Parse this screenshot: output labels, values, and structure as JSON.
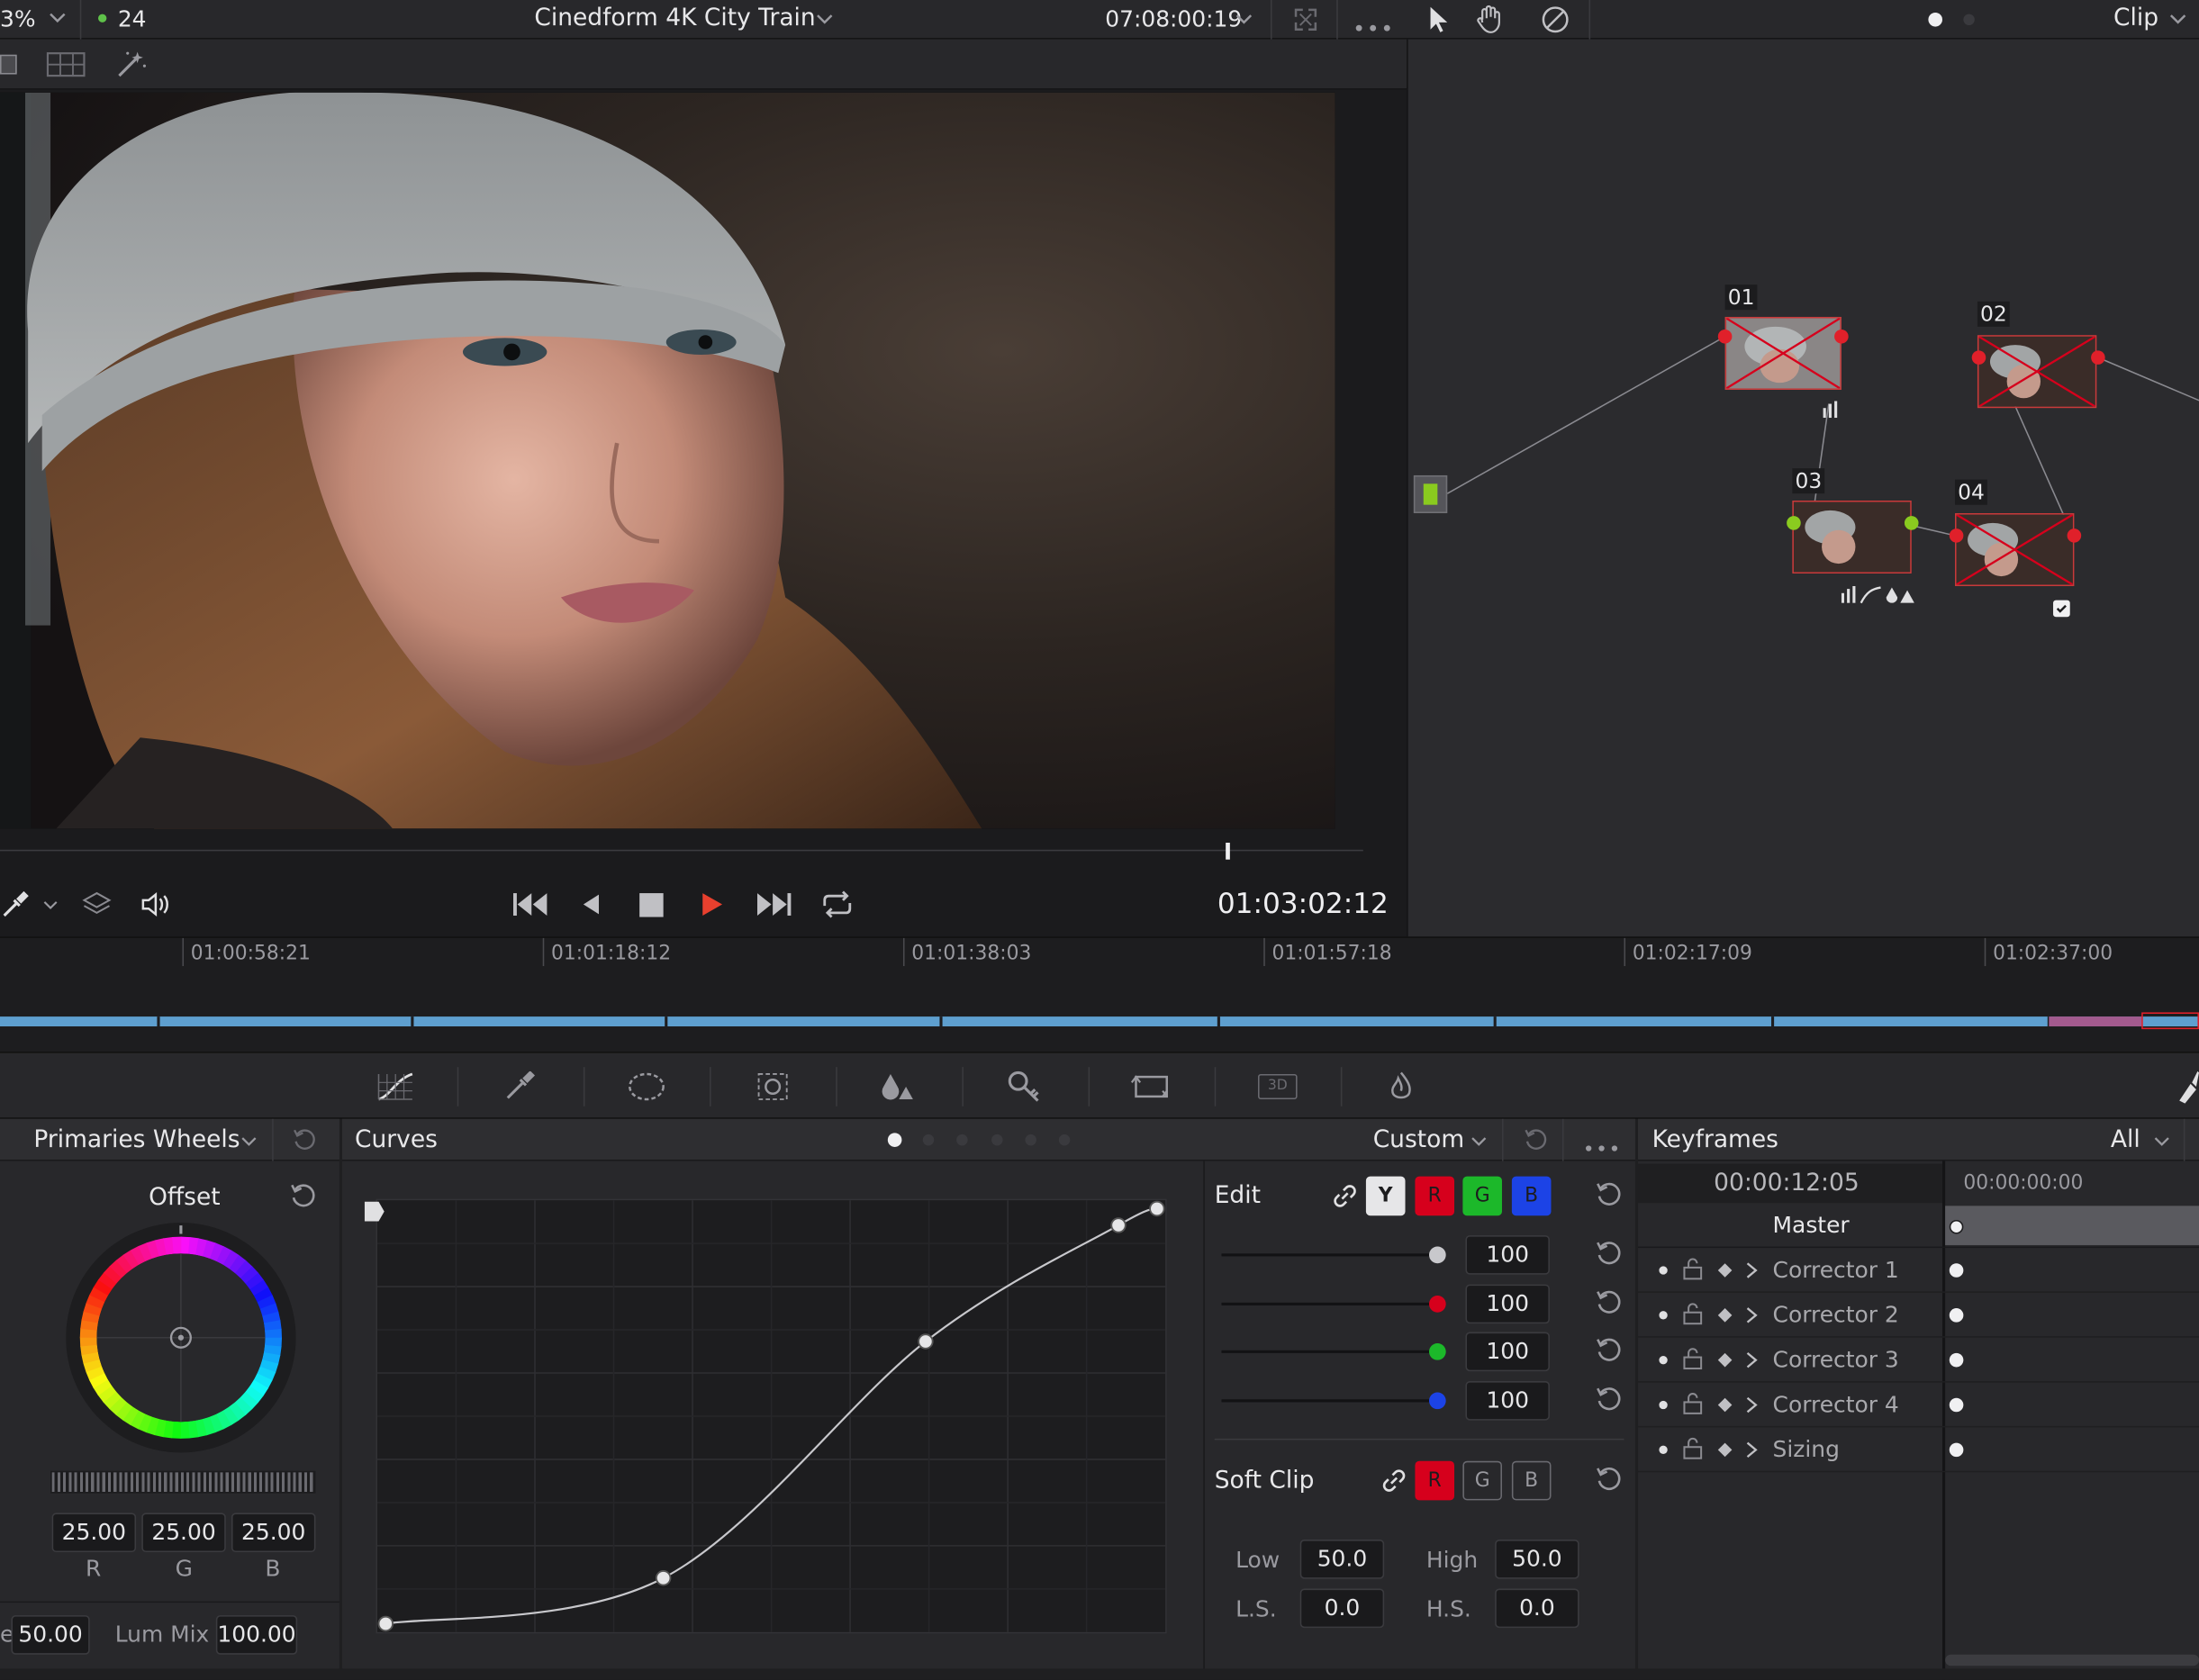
{
  "topbar": {
    "zoom": "3%",
    "fps": "24",
    "project_title": "Cinedform 4K City Train",
    "timecode": "07:08:00:19",
    "clip_label": "Clip"
  },
  "viewer": {
    "playback_timecode": "01:03:02:12",
    "scrub_position": 0.9
  },
  "nodes": [
    {
      "id": "01"
    },
    {
      "id": "02"
    },
    {
      "id": "03"
    },
    {
      "id": "04"
    }
  ],
  "timeline": {
    "ticks": [
      "01:00:58:21",
      "01:01:18:12",
      "01:01:38:03",
      "01:01:57:18",
      "01:02:17:09",
      "01:02:37:00"
    ]
  },
  "primaries": {
    "title": "Primaries Wheels",
    "wheel_label": "Offset",
    "r": "25.00",
    "g": "25.00",
    "b": "25.00",
    "r_label": "R",
    "g_label": "G",
    "b_label": "B",
    "left_value": "50.00",
    "lum_mix_label": "Lum Mix",
    "lum_mix_value": "100.00"
  },
  "curves": {
    "title": "Curves",
    "mode": "Custom",
    "points": [
      [
        0,
        0
      ],
      [
        0.36,
        0.11
      ],
      [
        0.7,
        0.68
      ],
      [
        0.95,
        0.96
      ],
      [
        1,
        1
      ]
    ]
  },
  "edit": {
    "title": "Edit",
    "y": "Y",
    "r": "R",
    "g": "G",
    "b": "B",
    "values": [
      "100",
      "100",
      "100",
      "100"
    ]
  },
  "softclip": {
    "title": "Soft Clip",
    "r": "R",
    "g": "G",
    "b": "B",
    "low_label": "Low",
    "low": "50.0",
    "high_label": "High",
    "high": "50.0",
    "ls_label": "L.S.",
    "ls": "0.0",
    "hs_label": "H.S.",
    "hs": "0.0"
  },
  "keyframes": {
    "title": "Keyframes",
    "filter": "All",
    "current_time": "00:00:12:05",
    "ruler_time": "00:00:00:00",
    "master_label": "Master",
    "rows": [
      "Corrector 1",
      "Corrector 2",
      "Corrector 3",
      "Corrector 4",
      "Sizing"
    ]
  },
  "colors": {
    "accent_red": "#e8402e",
    "selected_red": "#d6001c"
  }
}
